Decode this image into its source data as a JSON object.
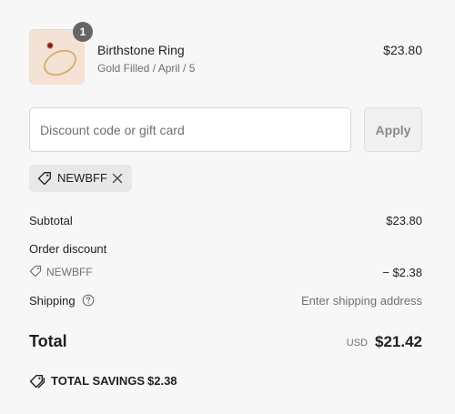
{
  "product": {
    "quantity": "1",
    "name": "Birthstone Ring",
    "variant": "Gold Filled / April / 5",
    "price": "$23.80",
    "image_icon": "ring-product-image"
  },
  "discount": {
    "placeholder": "Discount code or gift card",
    "value": "",
    "apply_label": "Apply",
    "applied_code": "NEWBFF"
  },
  "summary": {
    "subtotal_label": "Subtotal",
    "subtotal_value": "$23.80",
    "order_discount_label": "Order discount",
    "discount_code": "NEWBFF",
    "discount_value": "− $2.38",
    "shipping_label": "Shipping",
    "shipping_value": "Enter shipping address"
  },
  "total": {
    "label": "Total",
    "currency": "USD",
    "value": "$21.42"
  },
  "savings": {
    "label": "TOTAL SAVINGS",
    "value": "$2.38"
  },
  "colors": {
    "background": "#f7f7f7",
    "text": "#1f1f1f",
    "muted": "#707070",
    "badge": "#666666",
    "chip": "#e8e8e8"
  }
}
